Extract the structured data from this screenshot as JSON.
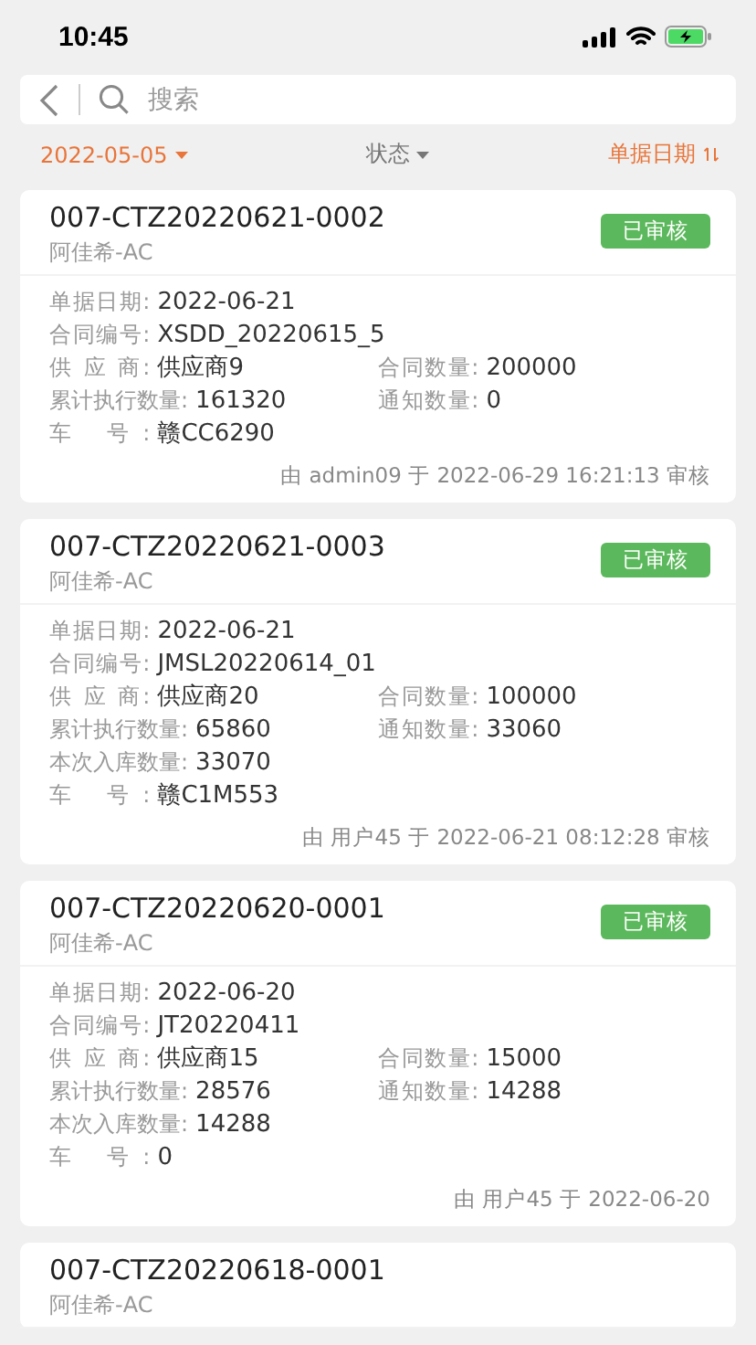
{
  "status_bar": {
    "time": "10:45"
  },
  "search": {
    "placeholder": "搜索"
  },
  "filters": [
    {
      "label": "2022-05-05",
      "kind": "dropdown",
      "active": true
    },
    {
      "label": "状态",
      "kind": "dropdown",
      "active": false
    },
    {
      "label": "单据日期",
      "kind": "sort",
      "active": true
    }
  ],
  "records": [
    {
      "number": "007-CTZ20220621-0002",
      "company": "阿佳希-AC",
      "status": "已审核",
      "rows": [
        [
          {
            "label": "单据日期:",
            "value": "2022-06-21"
          }
        ],
        [
          {
            "label": "合同编号:",
            "value": "XSDD_20220615_5"
          }
        ],
        [
          {
            "label": "供 应 商:",
            "value": "供应商9"
          },
          {
            "label": "合同数量:",
            "value": "200000"
          }
        ],
        [
          {
            "label": "累计执行数量:",
            "value": "161320"
          },
          {
            "label": "通知数量:",
            "value": "0"
          }
        ],
        [
          {
            "label": "车 号:",
            "value": "赣CC6290"
          }
        ]
      ],
      "footer": "由 admin09 于 2022-06-29 16:21:13 审核"
    },
    {
      "number": "007-CTZ20220621-0003",
      "company": "阿佳希-AC",
      "status": "已审核",
      "rows": [
        [
          {
            "label": "单据日期:",
            "value": "2022-06-21"
          }
        ],
        [
          {
            "label": "合同编号:",
            "value": "JMSL20220614_01"
          }
        ],
        [
          {
            "label": "供 应 商:",
            "value": "供应商20"
          },
          {
            "label": "合同数量:",
            "value": "100000"
          }
        ],
        [
          {
            "label": "累计执行数量:",
            "value": "65860"
          },
          {
            "label": "通知数量:",
            "value": "33060"
          }
        ],
        [
          {
            "label": "本次入库数量:",
            "value": "33070"
          }
        ],
        [
          {
            "label": "车 号:",
            "value": "赣C1M553"
          }
        ]
      ],
      "footer": "由 用户45 于 2022-06-21 08:12:28 审核"
    },
    {
      "number": "007-CTZ20220620-0001",
      "company": "阿佳希-AC",
      "status": "已审核",
      "rows": [
        [
          {
            "label": "单据日期:",
            "value": "2022-06-20"
          }
        ],
        [
          {
            "label": "合同编号:",
            "value": "JT20220411"
          }
        ],
        [
          {
            "label": "供 应 商:",
            "value": "供应商15"
          },
          {
            "label": "合同数量:",
            "value": "15000"
          }
        ],
        [
          {
            "label": "累计执行数量:",
            "value": "28576"
          },
          {
            "label": "通知数量:",
            "value": "14288"
          }
        ],
        [
          {
            "label": "本次入库数量:",
            "value": "14288"
          }
        ],
        [
          {
            "label": "车 号:",
            "value": "0"
          }
        ]
      ],
      "footer": "由 用户45 于 2022-06-20"
    },
    {
      "number": "007-CTZ20220618-0001",
      "company": "阿佳希-AC"
    }
  ]
}
